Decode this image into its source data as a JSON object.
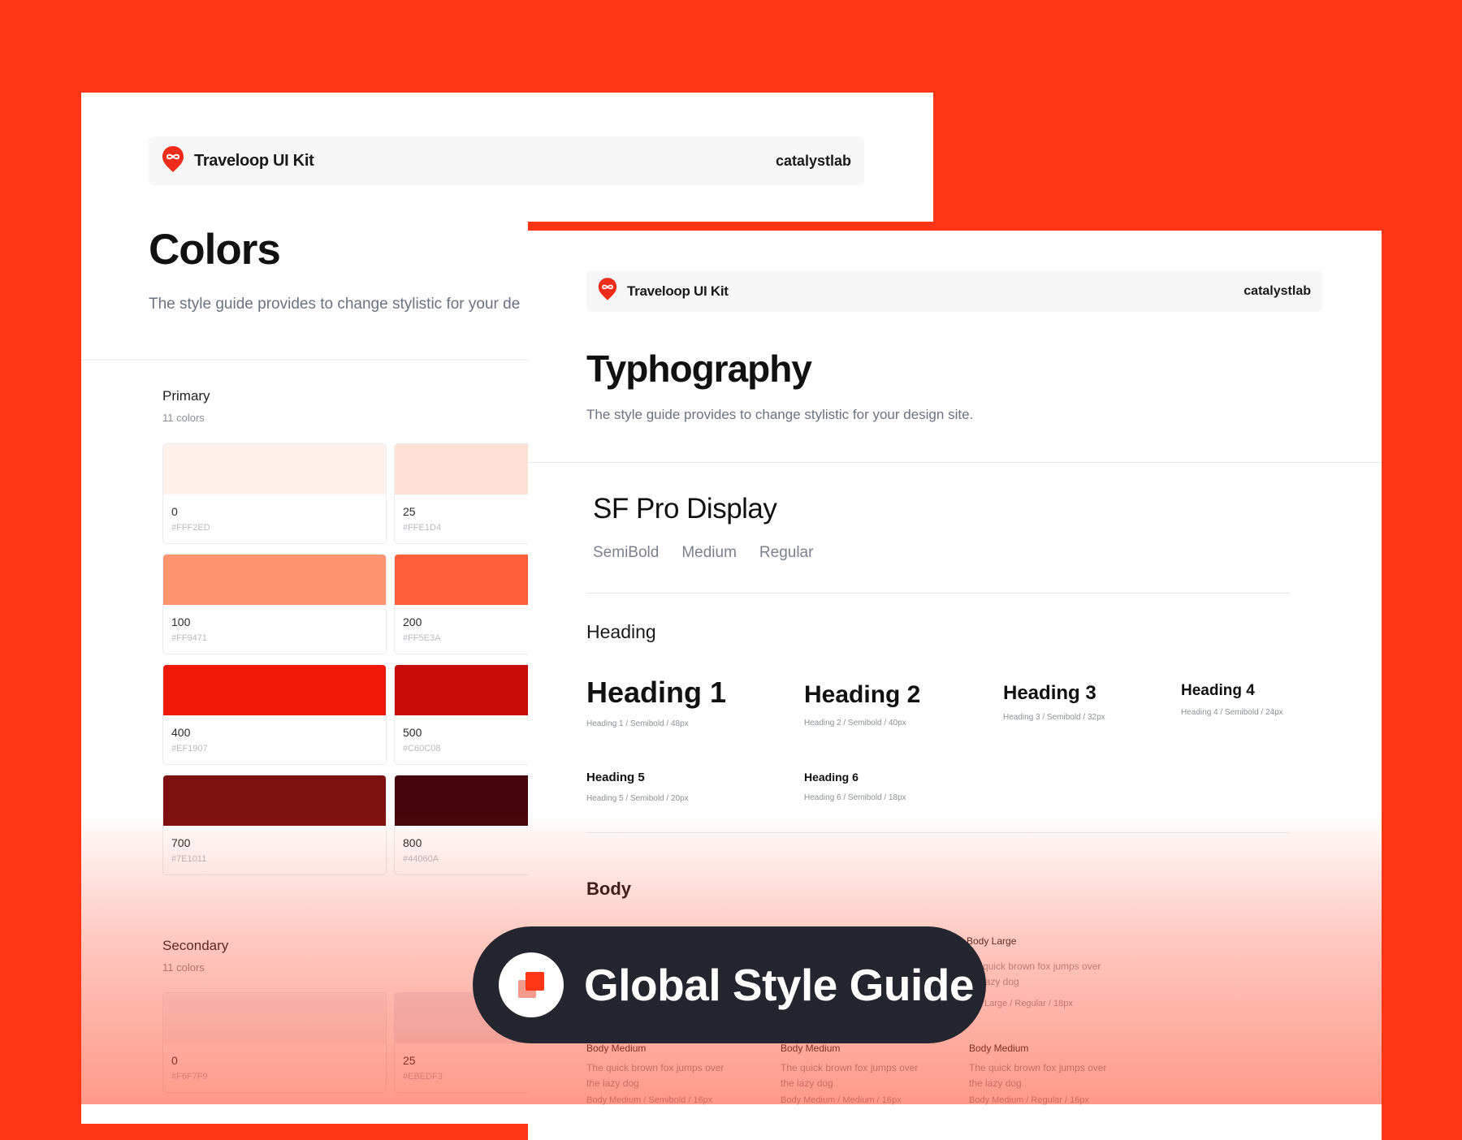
{
  "colors_page": {
    "brand_name": "Traveloop UI Kit",
    "org": "catalystlab",
    "title": "Colors",
    "description": "The style guide provides to change stylistic for your de",
    "primary": {
      "title": "Primary",
      "count": "11 colors",
      "swatches": [
        {
          "label": "0",
          "hex": "#FFF2ED",
          "color": "#FFF2ED"
        },
        {
          "label": "25",
          "hex": "#FFE1D4",
          "color": "#FFE1D4"
        },
        {
          "label": "100",
          "hex": "#FF9471",
          "color": "#FF9471"
        },
        {
          "label": "200",
          "hex": "#FF5E3A",
          "color": "#FF5E3A"
        },
        {
          "label": "400",
          "hex": "#EF1907",
          "color": "#EF1907"
        },
        {
          "label": "500",
          "hex": "#C60C08",
          "color": "#C60C08"
        },
        {
          "label": "700",
          "hex": "#7E1011",
          "color": "#7E1011"
        },
        {
          "label": "800",
          "hex": "#44060A",
          "color": "#44060A"
        }
      ]
    },
    "secondary": {
      "title": "Secondary",
      "count": "11 colors",
      "swatches": [
        {
          "label": "0",
          "hex": "#F6F7F9",
          "color": "#F6F7F9"
        },
        {
          "label": "25",
          "hex": "#EBEDF3",
          "color": "#EBEDF3"
        }
      ]
    }
  },
  "typography_page": {
    "brand_name": "Traveloop UI Kit",
    "org": "catalystlab",
    "title": "Typhography",
    "description": "The style guide provides to change stylistic for your design site.",
    "font_name": "SF Pro Display",
    "weights": [
      "SemiBold",
      "Medium",
      "Regular"
    ],
    "heading_section": "Heading",
    "headings": [
      {
        "label": "Heading 1",
        "caption": "Heading 1 / Semibold / 48px"
      },
      {
        "label": "Heading 2",
        "caption": "Heading 2 / Semibold / 40px"
      },
      {
        "label": "Heading 3",
        "caption": "Heading 3 / Semibold / 32px"
      },
      {
        "label": "Heading 4",
        "caption": "Heading 4 / Semibold / 24px"
      },
      {
        "label": "Heading 5",
        "caption": "Heading 5 / Semibold / 20px"
      },
      {
        "label": "Heading 6",
        "caption": "Heading 6 / Semibold / 18px"
      }
    ],
    "body_section": "Body",
    "body_large": {
      "title": "Body Large",
      "text": "quick brown fox jumps over lazy dog",
      "caption": "Large / Regular / 18px"
    },
    "body_medium": [
      {
        "title": "Body Medium",
        "text": "The quick brown fox jumps over the lazy dog",
        "caption": "Body Medium / Semibold / 16px"
      },
      {
        "title": "Body Medium",
        "text": "The quick brown fox jumps over the lazy dog",
        "caption": "Body Medium / Medium / 16px"
      },
      {
        "title": "Body Medium",
        "text": "The quick brown fox jumps over the lazy dog",
        "caption": "Body Medium / Regular / 16px"
      }
    ]
  },
  "badge": {
    "label": "Global Style Guide",
    "icon": "stacked-squares-icon"
  },
  "colors": {
    "background": "#FF3516",
    "logo": "#EF2B1A",
    "pill": "#23252F"
  }
}
